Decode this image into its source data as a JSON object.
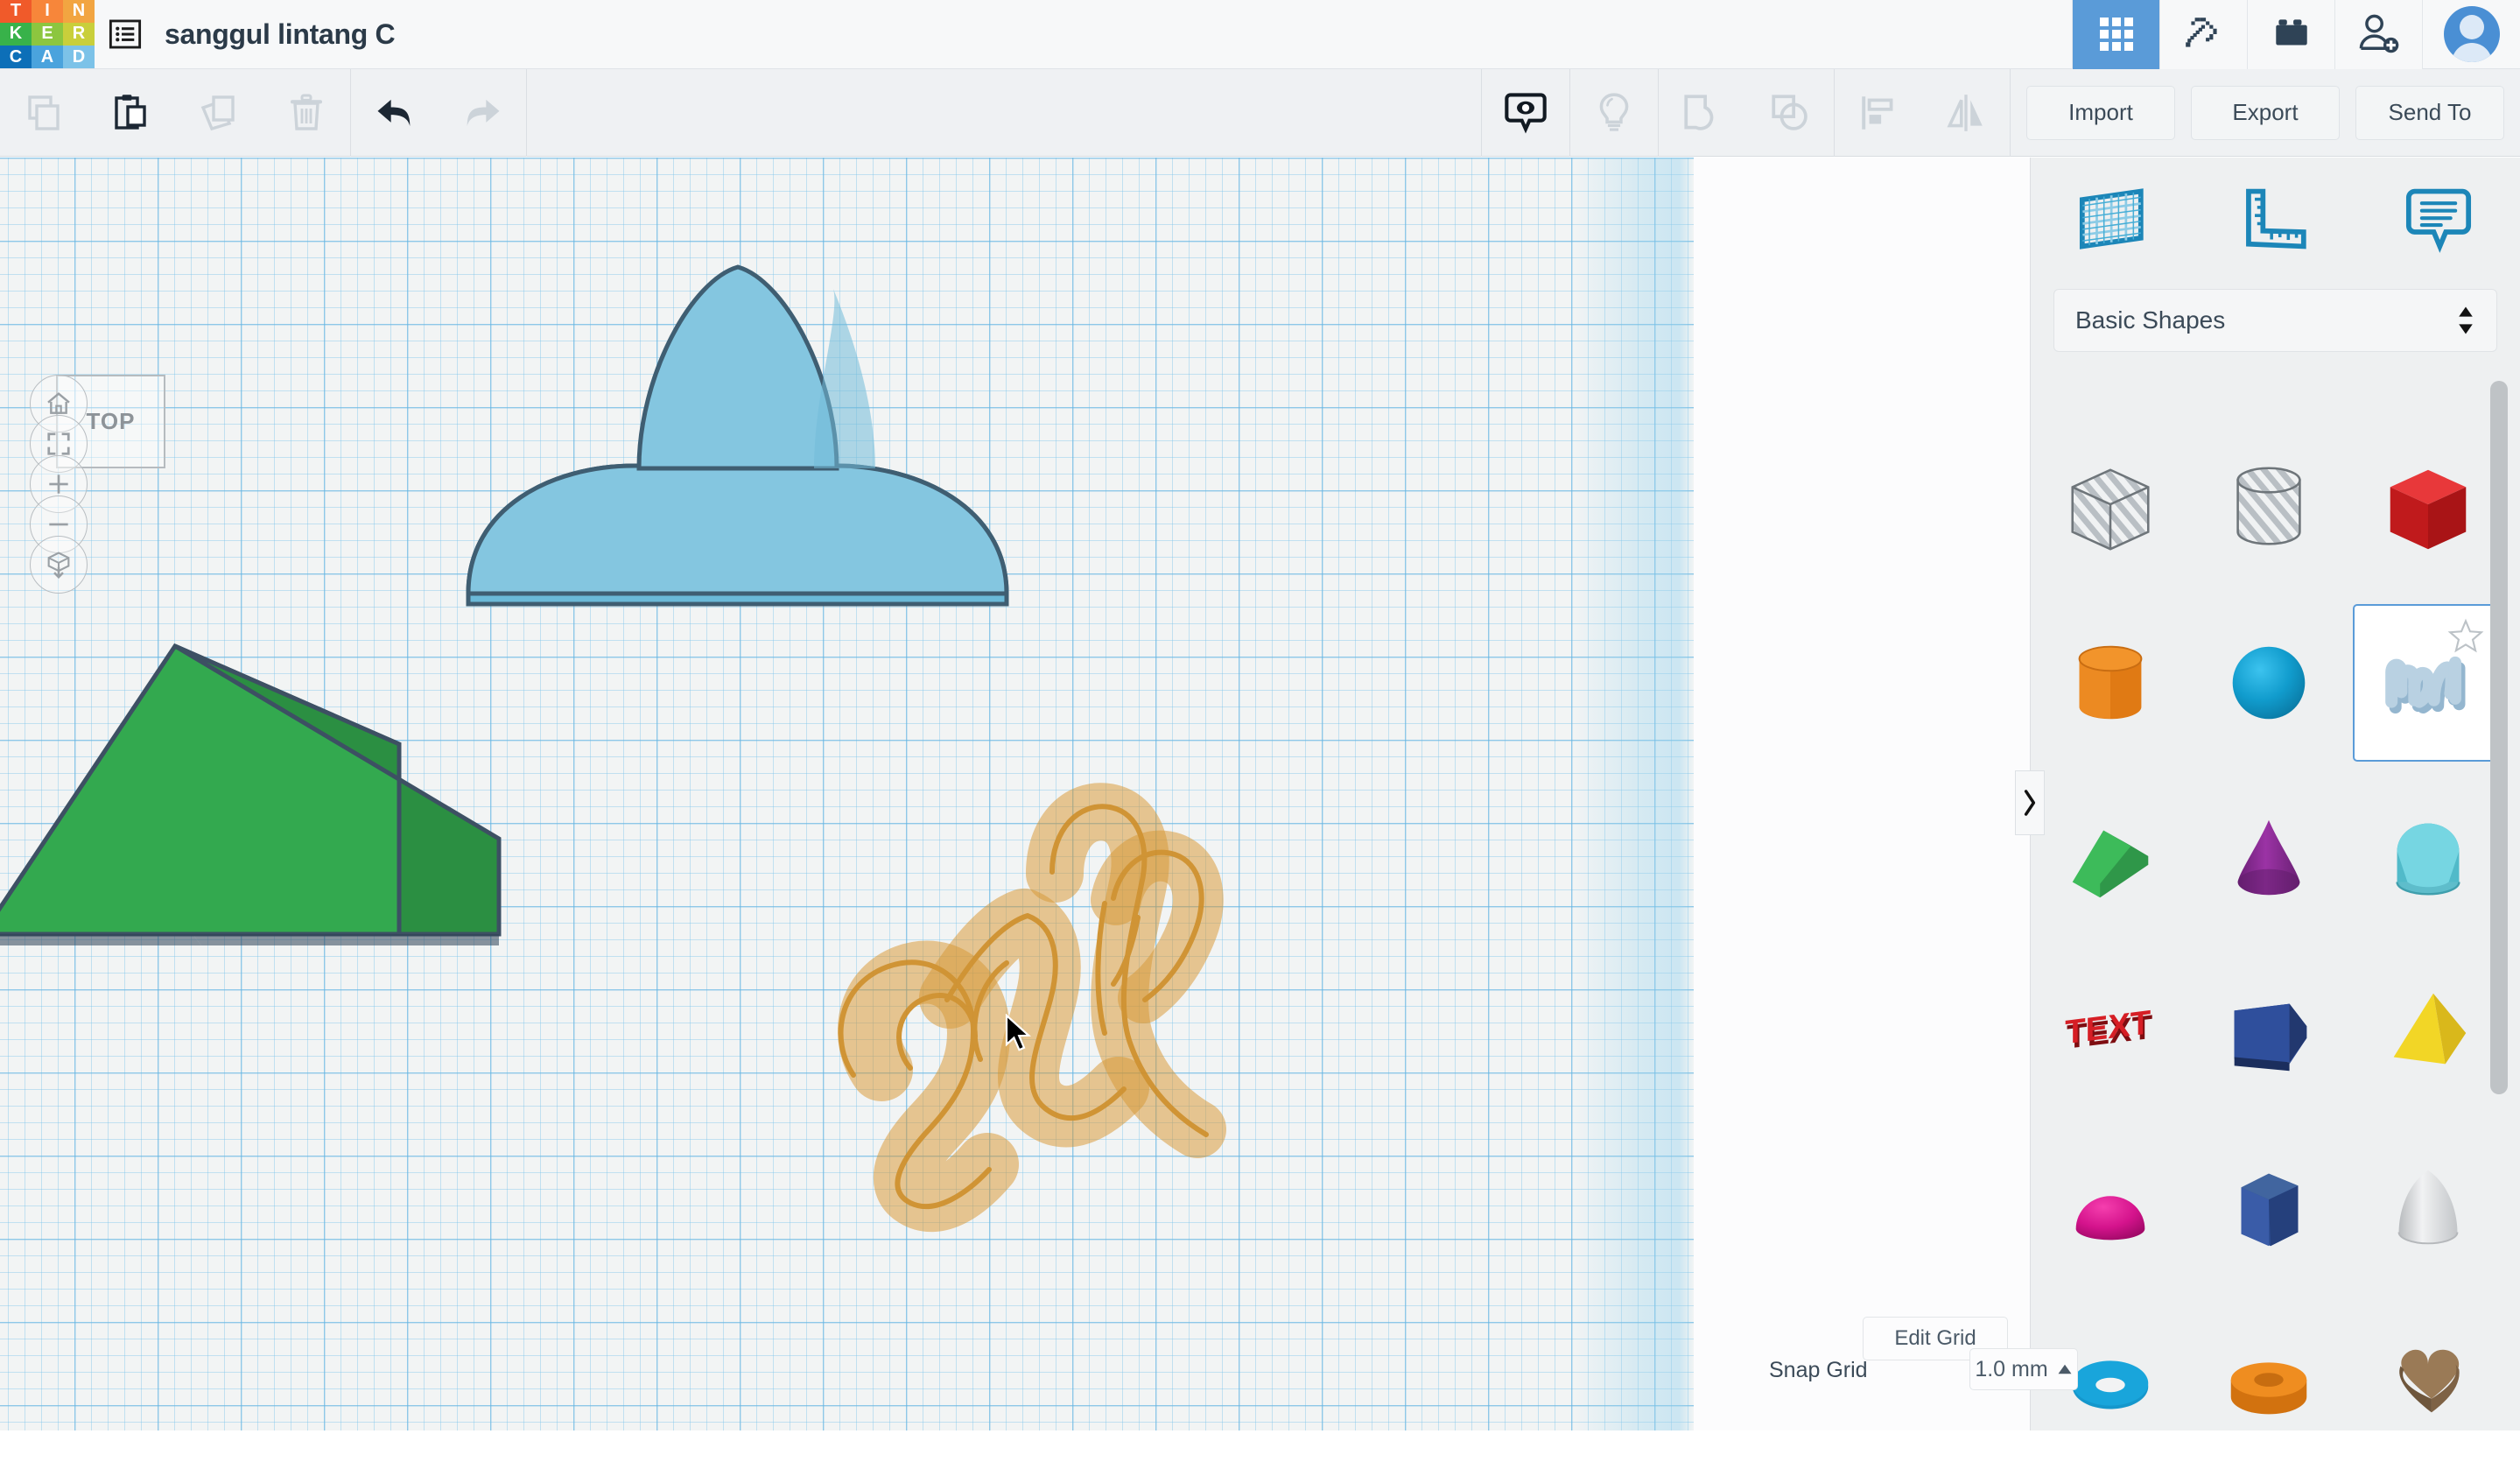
{
  "app": {
    "brand_letters": [
      "T",
      "I",
      "N",
      "K",
      "E",
      "R",
      "C",
      "A",
      "D"
    ],
    "brand_colors": [
      "#f05a2a",
      "#f7863a",
      "#f2a541",
      "#38b24a",
      "#8cc63f",
      "#c9cf3b",
      "#0d6fb8",
      "#4aa3dd",
      "#7cc2e8"
    ],
    "accent": "#5a9bd8",
    "document_title": "sanggul lintang C"
  },
  "topbar": {
    "menu_icon": "list-menu-icon",
    "right_buttons": [
      {
        "name": "blocks-grid-icon",
        "label": "3D Designs",
        "active": true
      },
      {
        "name": "pickaxe-icon",
        "label": "Minecraft",
        "active": false
      },
      {
        "name": "lego-brick-icon",
        "label": "Bricks",
        "active": false
      },
      {
        "name": "invite-person-icon",
        "label": "Invite",
        "active": false
      }
    ],
    "avatar": "user-avatar"
  },
  "toolbar": {
    "left_tools": [
      {
        "name": "copy-icon",
        "label": "Copy",
        "enabled": false
      },
      {
        "name": "paste-icon",
        "label": "Paste",
        "enabled": true
      },
      {
        "name": "duplicate-icon",
        "label": "Duplicate",
        "enabled": false
      },
      {
        "name": "delete-trash-icon",
        "label": "Delete",
        "enabled": false
      }
    ],
    "history_tools": [
      {
        "name": "undo-arrow-icon",
        "label": "Undo",
        "enabled": true
      },
      {
        "name": "redo-arrow-icon",
        "label": "Redo",
        "enabled": false
      }
    ],
    "center_tools": [
      {
        "name": "show-hide-eye-icon",
        "label": "Show/Hide",
        "enabled": true
      },
      {
        "name": "lightbulb-hint-icon",
        "label": "Hint",
        "enabled": false
      },
      {
        "name": "group-icon",
        "label": "Group",
        "enabled": false
      },
      {
        "name": "ungroup-icon",
        "label": "Ungroup",
        "enabled": false
      },
      {
        "name": "align-icon",
        "label": "Align",
        "enabled": false
      },
      {
        "name": "mirror-icon",
        "label": "Mirror",
        "enabled": false
      }
    ],
    "import_label": "Import",
    "export_label": "Export",
    "sendto_label": "Send To"
  },
  "canvas": {
    "viewcube_label": "TOP",
    "nav_buttons": [
      {
        "name": "home-view-icon",
        "label": "Home view"
      },
      {
        "name": "fit-to-view-icon",
        "label": "Fit all in view"
      },
      {
        "name": "zoom-in-icon",
        "label": "Zoom in"
      },
      {
        "name": "zoom-out-icon",
        "label": "Zoom out"
      },
      {
        "name": "perspective-toggle-icon",
        "label": "Switch to orthographic view"
      }
    ],
    "objects": [
      {
        "name": "blue-paraboloid-dome",
        "color": "#7cc2dd",
        "stroke": "#3f5e72"
      },
      {
        "name": "green-roof-wedge",
        "color": "#34a853",
        "stroke": "#3d5063"
      },
      {
        "name": "orange-scribble-ghost",
        "color": "#d9972e",
        "fill": "#eddcc0"
      }
    ],
    "cursor": "arrow-cursor"
  },
  "right_panel": {
    "header_icons": [
      {
        "name": "workplane-grid-icon",
        "label": "Workplane"
      },
      {
        "name": "ruler-icon",
        "label": "Ruler"
      },
      {
        "name": "note-comment-icon",
        "label": "Note"
      }
    ],
    "category_label": "Basic Shapes",
    "collapse_icon": "chevron-right-icon",
    "shapes": [
      {
        "name": "box-hole",
        "label": "Box Hole",
        "color": "#cfd3d6",
        "kind": "striped-cube",
        "selected": false
      },
      {
        "name": "cylinder-hole",
        "label": "Cylinder Hole",
        "color": "#cfd3d6",
        "kind": "striped-cylinder",
        "selected": false
      },
      {
        "name": "box",
        "label": "Box",
        "color": "#d42a2a",
        "kind": "cube",
        "selected": false
      },
      {
        "name": "cylinder",
        "label": "Cylinder",
        "color": "#e8821e",
        "kind": "cylinder",
        "selected": false
      },
      {
        "name": "sphere",
        "label": "Sphere",
        "color": "#0e9ccb",
        "kind": "sphere",
        "selected": false
      },
      {
        "name": "scribble",
        "label": "Scribble",
        "color": "#9dc2da",
        "kind": "scribble",
        "selected": true,
        "favorite": false
      },
      {
        "name": "roof",
        "label": "Roof",
        "color": "#31a84c",
        "kind": "wedge",
        "selected": false
      },
      {
        "name": "cone",
        "label": "Cone",
        "color": "#8e2d96",
        "kind": "cone",
        "selected": false
      },
      {
        "name": "half-cylinder",
        "label": "Half Cylinder",
        "color": "#56b8c4",
        "kind": "halfcyl",
        "selected": false
      },
      {
        "name": "text",
        "label": "Text",
        "color": "#cc1b22",
        "kind": "text",
        "selected": false
      },
      {
        "name": "house-block",
        "label": "House Block",
        "color": "#2b3e7e",
        "kind": "house",
        "selected": false
      },
      {
        "name": "pyramid",
        "label": "Pyramid",
        "color": "#edd022",
        "kind": "pyramid",
        "selected": false
      },
      {
        "name": "half-sphere",
        "label": "Half Sphere",
        "color": "#d9118c",
        "kind": "hemisphere",
        "selected": false
      },
      {
        "name": "hexagonal-prism",
        "label": "Hexagonal Prism",
        "color": "#2f4b8f",
        "kind": "hexprism",
        "selected": false
      },
      {
        "name": "paraboloid",
        "label": "Paraboloid",
        "color": "#d5d8da",
        "kind": "paraboloid",
        "selected": false
      },
      {
        "name": "torus",
        "label": "Torus",
        "color": "#1492c8",
        "kind": "torus",
        "selected": false
      },
      {
        "name": "tube",
        "label": "Tube",
        "color": "#e8821e",
        "kind": "tube",
        "selected": false
      },
      {
        "name": "heart",
        "label": "Heart",
        "color": "#8a6b4a",
        "kind": "heart",
        "selected": false
      }
    ],
    "shape_text_label": "TEXT"
  },
  "bottom_bar": {
    "edit_grid_label": "Edit Grid",
    "snap_grid_label": "Snap Grid",
    "snap_grid_value": "1.0 mm",
    "snap_caret": "caret-up-icon"
  }
}
